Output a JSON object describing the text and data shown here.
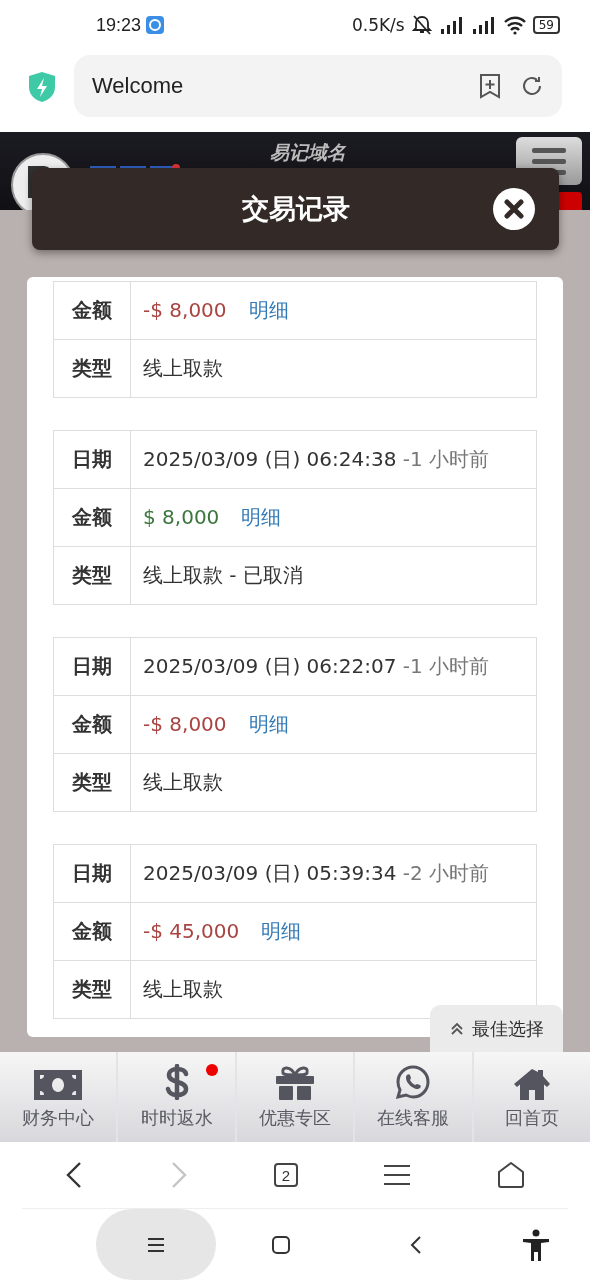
{
  "status_bar": {
    "time": "19:23",
    "speed": "0.5K/s",
    "battery": "59"
  },
  "browser": {
    "title": "Welcome",
    "tab_count": "2",
    "forward_disabled": true
  },
  "site_header": {
    "tagline": "易记域名"
  },
  "modal": {
    "title": "交易记录"
  },
  "records": [
    {
      "amount": "-$ 8,000",
      "color": "#a94442",
      "detail_link": "明细",
      "type": "线上取款",
      "labels": {
        "amount": "金额",
        "type": "类型"
      }
    },
    {
      "date": "2025/03/09 (日) 06:24:38",
      "ago": "-1 小时前",
      "amount": "$ 8,000",
      "color": "#3c763d",
      "detail_link": "明细",
      "type": "线上取款 - 已取消",
      "labels": {
        "date": "日期",
        "amount": "金额",
        "type": "类型"
      }
    },
    {
      "date": "2025/03/09 (日) 06:22:07",
      "ago": "-1 小时前",
      "amount": "-$ 8,000",
      "color": "#a94442",
      "detail_link": "明细",
      "type": "线上取款",
      "labels": {
        "date": "日期",
        "amount": "金额",
        "type": "类型"
      }
    },
    {
      "date": "2025/03/09 (日) 05:39:34",
      "ago": "-2 小时前",
      "amount": "-$ 45,000",
      "color": "#a94442",
      "detail_link": "明细",
      "type": "线上取款",
      "labels": {
        "date": "日期",
        "amount": "金额",
        "type": "类型"
      }
    }
  ],
  "floating_tab": {
    "label": "最佳选择"
  },
  "bottom_nav": [
    {
      "kind": "money",
      "label": "财务中心",
      "badge": false
    },
    {
      "kind": "dollar",
      "label": "时时返水",
      "badge": true
    },
    {
      "kind": "gift",
      "label": "优惠专区",
      "badge": false
    },
    {
      "kind": "chat",
      "label": "在线客服",
      "badge": false
    },
    {
      "kind": "home",
      "label": "回首页",
      "badge": false
    }
  ]
}
